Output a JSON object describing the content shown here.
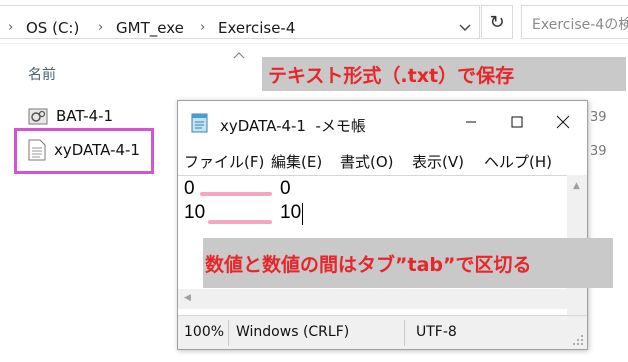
{
  "address_bar": {
    "breadcrumbs": [
      "OS (C:)",
      "GMT_exe",
      "Exercise-4"
    ],
    "refresh_icon": "refresh-icon",
    "search_placeholder": "Exercise-4の検"
  },
  "file_list": {
    "column_name": "名前",
    "files": [
      {
        "name": "BAT-4-1",
        "icon": "batch-file-icon",
        "trailing": "39"
      },
      {
        "name": "xyDATA-4-1",
        "icon": "text-file-icon",
        "trailing": "39"
      }
    ]
  },
  "annotations": {
    "top": "テキスト形式（.txt）で保存",
    "middle": "数値と数値の間はタブ”tab”で区切る",
    "highlight_color": "#d455d4",
    "text_color": "#e8262a",
    "tab_marker_color": "#f4a6c2"
  },
  "notepad": {
    "title": "xyDATA-4-1  -メモ帳",
    "menu": [
      "ファイル(F)",
      "編集(E)",
      "書式(O)",
      "表示(V)",
      "ヘルプ(H)"
    ],
    "lines": [
      {
        "x": "0",
        "y": "0"
      },
      {
        "x": "10",
        "y": "10"
      }
    ],
    "status": {
      "zoom": "100%",
      "line_ending": "Windows (CRLF)",
      "encoding": "UTF-8"
    }
  }
}
